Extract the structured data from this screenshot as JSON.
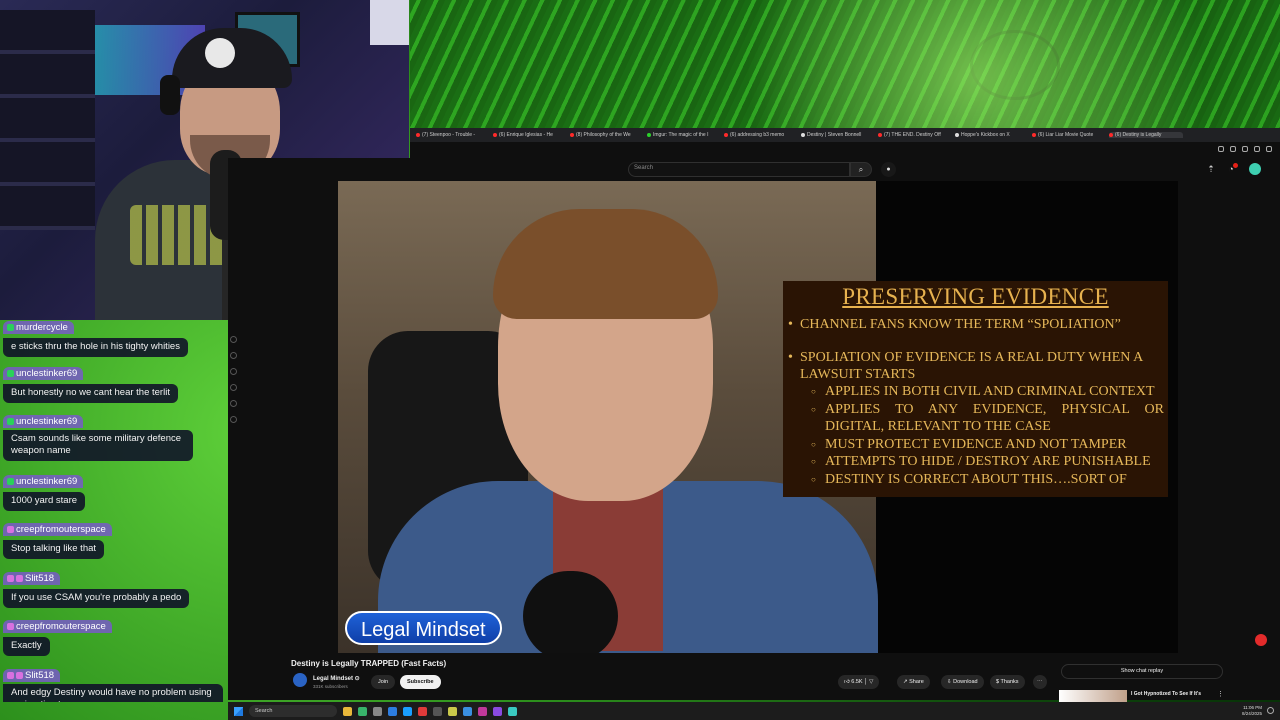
{
  "browser": {
    "tabs": [
      {
        "label": "(7) Steenpoo - Trouble -"
      },
      {
        "label": "(6) Enrique Iglesias - He"
      },
      {
        "label": "(8) Philosophy of the We"
      },
      {
        "label": "Imgur: The magic of the I"
      },
      {
        "label": "(6) addressing b3 memo"
      },
      {
        "label": "Destiny | Steven Bonnell"
      },
      {
        "label": "(7) THE END. Destiny Off"
      },
      {
        "label": "Hoppe's Kickbox on X"
      },
      {
        "label": "(6) Liar Liar Movie Quote"
      },
      {
        "label": "(6) Destiny is Legally"
      }
    ]
  },
  "youtube": {
    "search_placeholder": "Search",
    "video": {
      "slide_title": "PRESERVING EVIDENCE",
      "bullets": [
        "CHANNEL FANS KNOW THE TERM “SPOLIATION”",
        "SPOLIATION OF EVIDENCE IS A REAL DUTY WHEN A LAWSUIT STARTS"
      ],
      "sub_bullets": [
        "APPLIES IN BOTH CIVIL AND CRIMINAL CONTEXT",
        "APPLIES TO ANY EVIDENCE, PHYSICAL OR DIGITAL, RELEVANT TO THE CASE",
        "MUST PROTECT EVIDENCE AND NOT TAMPER",
        "ATTEMPTS TO HIDE / DESTROY ARE PUNISHABLE",
        "DESTINY IS CORRECT ABOUT THIS….SORT OF"
      ],
      "lower_third": "Legal Mindset"
    },
    "title": "Destiny is Legally TRAPPED (Fast Facts)",
    "channel": {
      "name": "Legal Mindset ⊙",
      "subs": "331K subscribers"
    },
    "join_label": "Join",
    "subscribe_label": "Subscribe",
    "actions": {
      "likes": "6.5K",
      "share": "Share",
      "download": "Download",
      "thanks": "Thanks",
      "more": "⋯"
    },
    "show_chat_replay": "Show chat replay",
    "recommended": {
      "title": "I Got Hypnotized To See If It's",
      "more": "⋮"
    }
  },
  "chat": {
    "messages": [
      {
        "user": "",
        "text": "e sticks thru the hole in his tighty whities"
      },
      {
        "user": "unclestinker69",
        "text": "But honestly no we cant hear the terlit"
      },
      {
        "user": "unclestinker69",
        "text": "Csam sounds like some military defence weapon name"
      },
      {
        "user": "unclestinker69",
        "text": "1000 yard stare"
      },
      {
        "user": "creepfromouterspace",
        "text": "Stop talking like that"
      },
      {
        "user": "Slit518",
        "text": "If you use CSAM you're probably a pedo"
      },
      {
        "user": "creepfromouterspace",
        "text": "Exactly"
      },
      {
        "user": "Slit518",
        "text": "And edgy Destiny would have no problem using projerative terms."
      }
    ],
    "partial_top_user": "murdercycle"
  },
  "taskbar": {
    "search": "Search",
    "time": "11:06 PM",
    "date": "8/24/2025"
  }
}
